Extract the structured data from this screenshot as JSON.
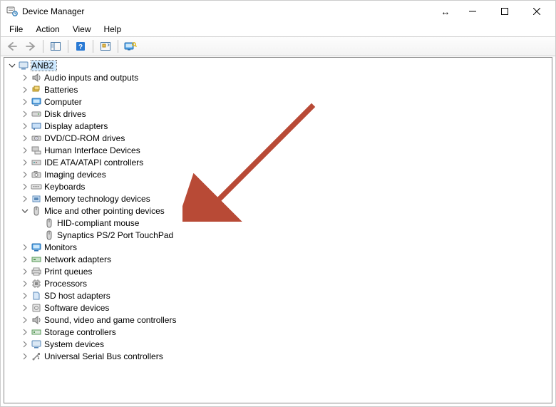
{
  "window": {
    "title": "Device Manager"
  },
  "menu": {
    "file": "File",
    "action": "Action",
    "view": "View",
    "help": "Help"
  },
  "tree": {
    "root": "ANB2",
    "cat": {
      "audio": "Audio inputs and outputs",
      "batteries": "Batteries",
      "computer": "Computer",
      "disk": "Disk drives",
      "display": "Display adapters",
      "dvd": "DVD/CD-ROM drives",
      "hid": "Human Interface Devices",
      "ide": "IDE ATA/ATAPI controllers",
      "imaging": "Imaging devices",
      "keyboards": "Keyboards",
      "memtech": "Memory technology devices",
      "mice": "Mice and other pointing devices",
      "monitors": "Monitors",
      "network": "Network adapters",
      "printq": "Print queues",
      "processors": "Processors",
      "sdhost": "SD host adapters",
      "software": "Software devices",
      "sound": "Sound, video and game controllers",
      "storage": "Storage controllers",
      "system": "System devices",
      "usb": "Universal Serial Bus controllers"
    },
    "mice_children": {
      "hid_mouse": "HID-compliant mouse",
      "synaptics": "Synaptics PS/2 Port TouchPad"
    }
  }
}
